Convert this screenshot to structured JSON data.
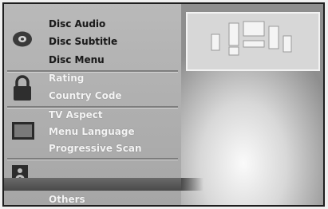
{
  "menu": {
    "groups": [
      {
        "icon": "disc-icon",
        "items": [
          {
            "label": "Disc Audio",
            "state": "active"
          },
          {
            "label": "Disc Subtitle",
            "state": "active"
          },
          {
            "label": "Disc Menu",
            "state": "active"
          }
        ]
      },
      {
        "icon": "lock-icon",
        "items": [
          {
            "label": "Rating",
            "state": "inactive"
          },
          {
            "label": "Country Code",
            "state": "inactive"
          }
        ]
      },
      {
        "icon": "tv-icon",
        "items": [
          {
            "label": "TV Aspect",
            "state": "inactive"
          },
          {
            "label": "Menu Language",
            "state": "inactive"
          },
          {
            "label": "Progressive Scan",
            "state": "inactive"
          }
        ]
      },
      {
        "icon": "speaker-icon",
        "items": []
      },
      {
        "icon": "",
        "items": [
          {
            "label": "Others",
            "state": "inactive"
          }
        ]
      }
    ]
  },
  "preview": {
    "icon": "speaker-layout-icon"
  }
}
